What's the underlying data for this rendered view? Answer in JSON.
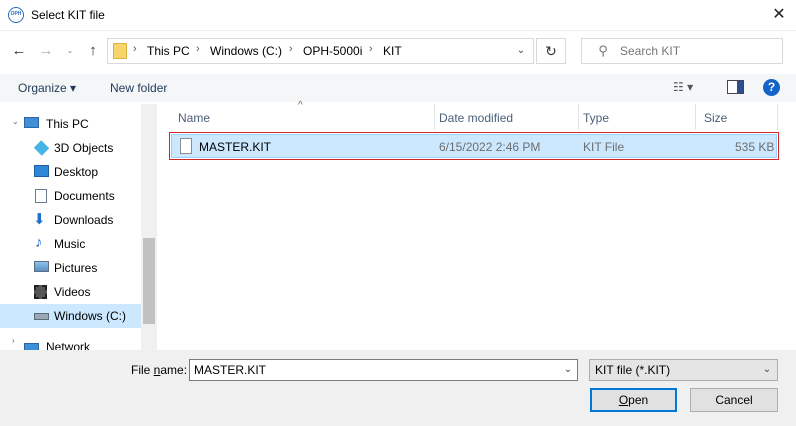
{
  "window": {
    "title": "Select KIT file",
    "app_icon_text": "OPH",
    "close_glyph": "✕"
  },
  "nav": {
    "back_glyph": "←",
    "forward_glyph": "→",
    "recent_glyph": "⌄",
    "up_glyph": "↑",
    "breadcrumbs": [
      "This PC",
      "Windows (C:)",
      "OPH-5000i",
      "KIT"
    ],
    "separator": "›",
    "refresh_glyph": "↻",
    "search_placeholder": "Search KIT"
  },
  "toolbar": {
    "organize": "Organize ▾",
    "new_folder": "New folder",
    "view_glyph": "☷ ▾",
    "help": "?"
  },
  "sidebar": {
    "items": [
      {
        "label": "This PC",
        "icon": "computer-icon"
      },
      {
        "label": "3D Objects",
        "icon": "cube-icon"
      },
      {
        "label": "Desktop",
        "icon": "desktop-icon"
      },
      {
        "label": "Documents",
        "icon": "documents-icon"
      },
      {
        "label": "Downloads",
        "icon": "download-icon"
      },
      {
        "label": "Music",
        "icon": "music-icon"
      },
      {
        "label": "Pictures",
        "icon": "pictures-icon"
      },
      {
        "label": "Videos",
        "icon": "video-icon"
      },
      {
        "label": "Windows (C:)",
        "icon": "drive-icon"
      },
      {
        "label": "Network",
        "icon": "network-icon"
      }
    ],
    "selected": "Windows (C:)"
  },
  "file_list": {
    "columns": [
      "Name",
      "Date modified",
      "Type",
      "Size"
    ],
    "sort_glyph": "^",
    "rows": [
      {
        "name": "MASTER.KIT",
        "date": "6/15/2022 2:46 PM",
        "type": "KIT File",
        "size": "535 KB"
      }
    ]
  },
  "bottom": {
    "filename_label_pre": "File ",
    "filename_label_accel": "n",
    "filename_label_post": "ame:",
    "filename_value": "MASTER.KIT",
    "filter": "KIT file (*.KIT)",
    "open_accel": "O",
    "open_rest": "pen",
    "cancel": "Cancel",
    "dropdown_glyph": "⌄"
  },
  "colors": {
    "accent": "#0078d7",
    "selection": "#cce8ff",
    "highlight_border": "#d02626"
  }
}
